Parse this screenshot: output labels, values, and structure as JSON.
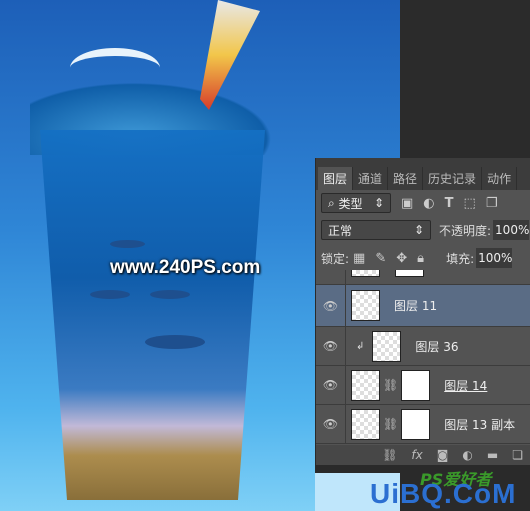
{
  "canvas": {
    "watermark": "www.240PS.com"
  },
  "panel": {
    "tabs": [
      {
        "label": "图层",
        "active": true
      },
      {
        "label": "通道"
      },
      {
        "label": "路径"
      },
      {
        "label": "历史记录"
      },
      {
        "label": "动作"
      }
    ],
    "filter": {
      "value": "类型",
      "icons": [
        "image-filter-icon",
        "adjustment-filter-icon",
        "type-filter-icon",
        "shape-filter-icon",
        "smart-object-filter-icon"
      ]
    },
    "blend": {
      "value": "正常",
      "opacity_label": "不透明度:",
      "opacity": "100%"
    },
    "lock": {
      "label": "锁定:",
      "fill_label": "填充:",
      "fill": "100%"
    },
    "layers": [
      {
        "name": "图层 11",
        "selected": true
      },
      {
        "name": "图层 36",
        "clipped": true
      },
      {
        "name": "图层 14",
        "mask": true
      },
      {
        "name": "图层 13 副本",
        "mask": true
      }
    ],
    "bottom": {
      "fx": "fx"
    }
  },
  "footer": {
    "logo": "UiBQ.CoM",
    "ps_logo": "PS爱好者"
  }
}
